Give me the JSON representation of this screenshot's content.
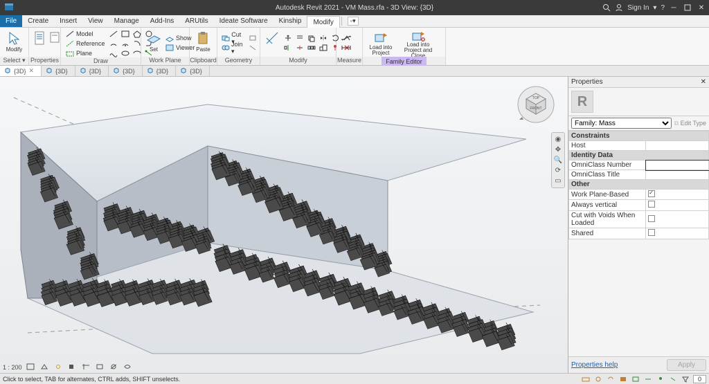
{
  "app": {
    "title": "Autodesk Revit 2021 - VM Mass.rfa - 3D View: {3D}",
    "signin": "Sign In"
  },
  "menu": {
    "file": "File",
    "tabs": [
      "Create",
      "Insert",
      "View",
      "Manage",
      "Add-Ins",
      "ARUtils",
      "Ideate Software",
      "Kinship",
      "Modify"
    ],
    "active": "Modify",
    "trail": ""
  },
  "ribbon": {
    "select": {
      "label": "Select ▾",
      "modify": "Modify"
    },
    "properties": {
      "label": "Properties",
      "props": "Properties",
      "family": "Family\nTypes"
    },
    "draw": {
      "label": "Draw",
      "model": "Model",
      "reference": "Reference",
      "plane": "Plane"
    },
    "workplane": {
      "label": "Work Plane",
      "set": "Set",
      "show": "Show",
      "viewer": "Viewer"
    },
    "clipboard": {
      "label": "Clipboard",
      "paste": "Paste",
      "cut": "Cut ▾",
      "join": "Join ▾"
    },
    "geometry": {
      "label": "Geometry"
    },
    "modify": {
      "label": "Modify"
    },
    "measure": {
      "label": "Measure"
    },
    "familyeditor": {
      "label": "Family Editor",
      "load_project": "Load into\nProject",
      "load_close": "Load into\nProject and Close"
    }
  },
  "viewtabs": [
    {
      "icon": "cube",
      "name": "{3D}",
      "active": true
    },
    {
      "icon": "cube",
      "name": "{3D}"
    },
    {
      "icon": "cube",
      "name": "{3D}"
    },
    {
      "icon": "cube",
      "name": "{3D}"
    },
    {
      "icon": "cube",
      "name": "{3D}"
    },
    {
      "icon": "cube",
      "name": "{3D}"
    }
  ],
  "viewcube": {
    "top": "TOP",
    "front": "FRONT"
  },
  "viewstatus": {
    "scale": "1 : 200"
  },
  "props": {
    "title": "Properties",
    "family_sel": "Family: Mass",
    "edit_type": "Edit Type",
    "sections": {
      "constraints": "Constraints",
      "identity": "Identity Data",
      "other": "Other"
    },
    "rows": {
      "host": {
        "k": "Host",
        "v": ""
      },
      "omni_num": {
        "k": "OmniClass Number",
        "v": ""
      },
      "omni_title": {
        "k": "OmniClass Title",
        "v": ""
      },
      "wp_based": {
        "k": "Work Plane-Based",
        "checked": true
      },
      "always_vertical": {
        "k": "Always vertical",
        "checked": false
      },
      "cut_voids": {
        "k": "Cut with Voids When Loaded",
        "checked": false
      },
      "shared": {
        "k": "Shared",
        "checked": false
      }
    },
    "help": "Properties help",
    "apply": "Apply"
  },
  "statusbar": {
    "msg": "Click to select, TAB for alternates, CTRL adds, SHIFT unselects.",
    "filter_count": "0"
  }
}
